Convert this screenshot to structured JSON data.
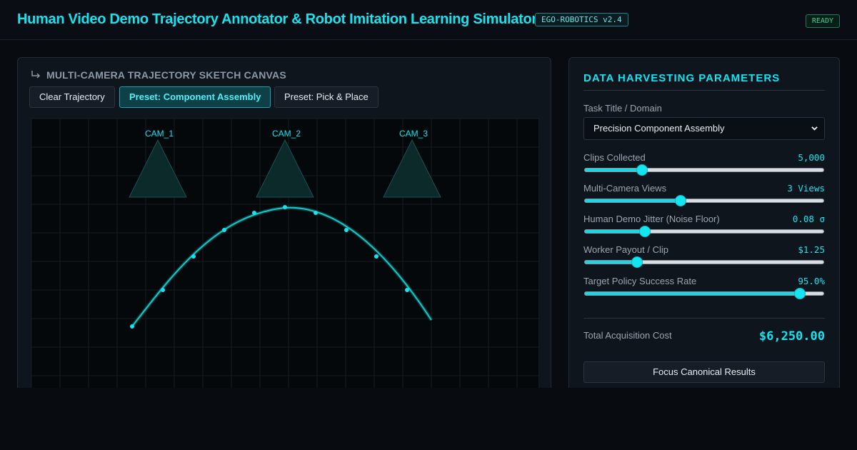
{
  "header": {
    "title": "Human Video Demo Trajectory Annotator & Robot Imitation Learning Simulator",
    "version_badge": "EGO-ROBOTICS v2.4",
    "status": "READY"
  },
  "canvas_panel": {
    "heading": "MULTI-CAMERA TRAJECTORY SKETCH CANVAS",
    "heading_icon": "corner-down-right-arrow-icon",
    "buttons": [
      {
        "label": "Clear Trajectory",
        "active": false
      },
      {
        "label": "Preset: Component Assembly",
        "active": true
      },
      {
        "label": "Preset: Pick & Place",
        "active": false
      }
    ],
    "cameras": [
      {
        "label": "CAM_1"
      },
      {
        "label": "CAM_2"
      },
      {
        "label": "CAM_3"
      }
    ],
    "colors": {
      "trajectory": "#14c8c8",
      "camera_frustum_fill": "#0d2a2a",
      "camera_frustum_stroke": "#135353",
      "grid": "#141b22"
    }
  },
  "params_panel": {
    "title": "DATA HARVESTING PARAMETERS",
    "task_label": "Task Title / Domain",
    "task_selected": "Precision Component Assembly",
    "sliders": [
      {
        "label": "Clips Collected",
        "value_text": "5,000",
        "fraction": 0.24
      },
      {
        "label": "Multi-Camera Views",
        "value_text": "3 Views",
        "fraction": 0.4
      },
      {
        "label": "Human Demo Jitter (Noise Floor)",
        "value_text": "0.08 σ",
        "fraction": 0.25
      },
      {
        "label": "Worker Payout / Clip",
        "value_text": "$1.25",
        "fraction": 0.22
      },
      {
        "label": "Target Policy Success Rate",
        "value_text": "95.0%",
        "fraction": 0.9
      }
    ],
    "total_cost_label": "Total Acquisition Cost",
    "total_cost_value": "$6,250.00",
    "focus_button_label": "Focus Canonical Results"
  },
  "colors": {
    "accent": "#14e3f0",
    "background": "#080c11",
    "panel": "#0f151d",
    "status_green": "#3fcf8e"
  }
}
